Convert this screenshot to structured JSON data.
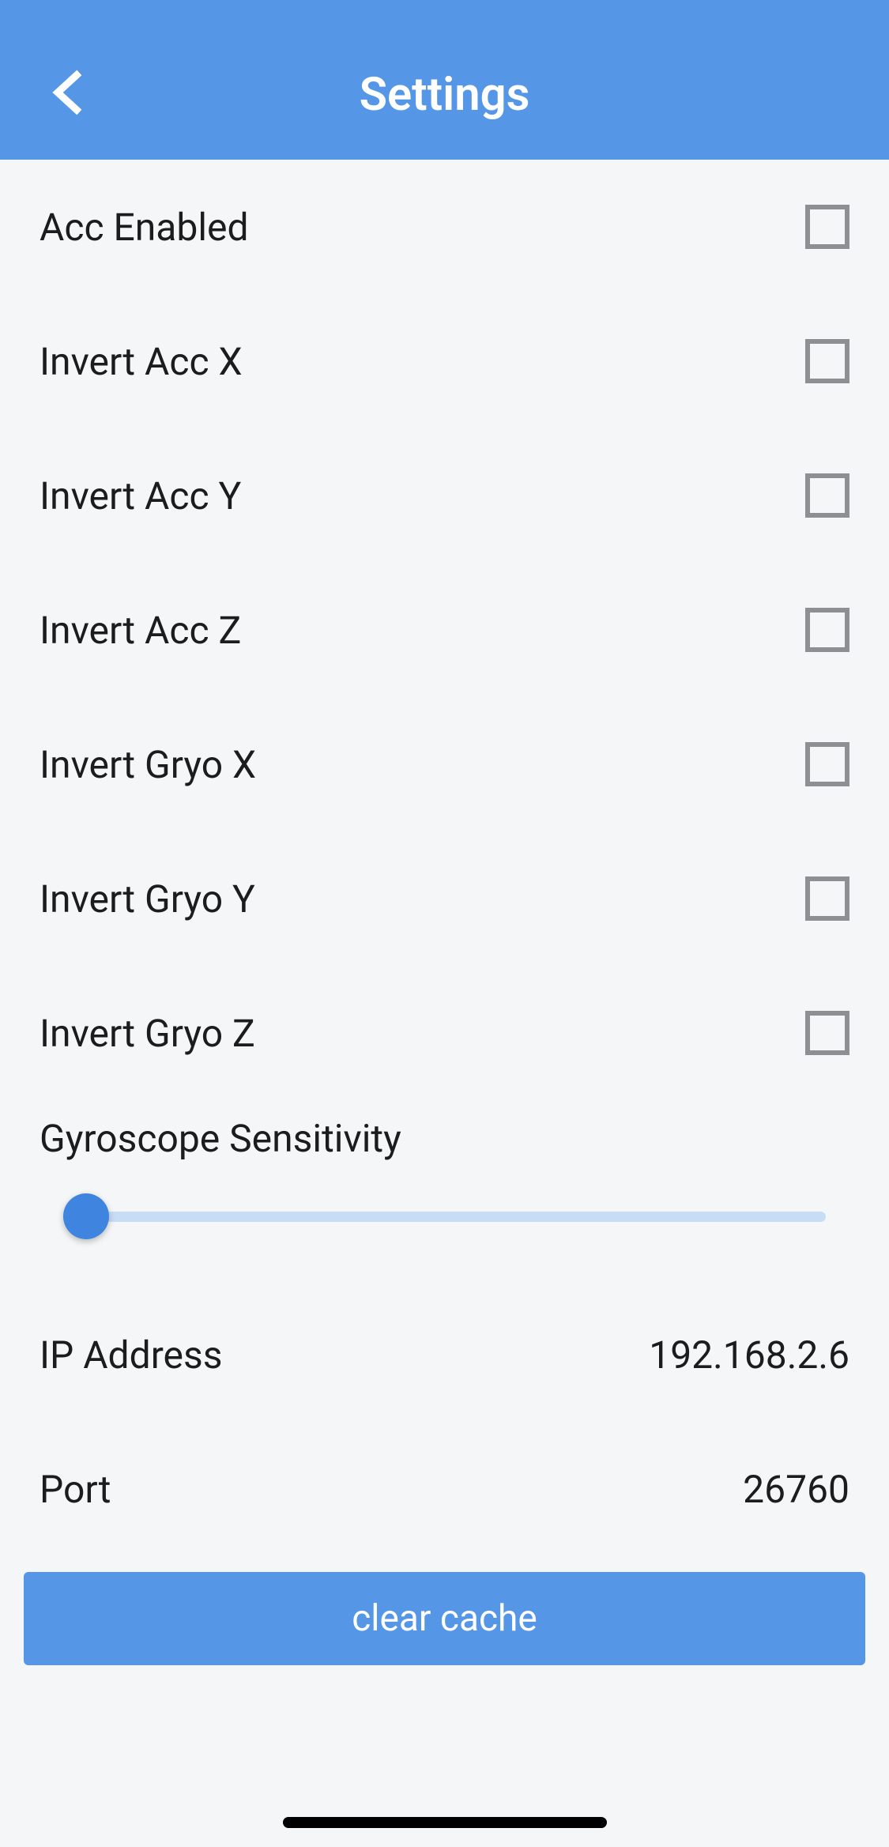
{
  "header": {
    "title": "Settings"
  },
  "checkboxes": [
    {
      "label": "Acc Enabled"
    },
    {
      "label": "Invert Acc X"
    },
    {
      "label": "Invert Acc Y"
    },
    {
      "label": "Invert Acc Z"
    },
    {
      "label": "Invert Gryo X"
    },
    {
      "label": "Invert Gryo Y"
    },
    {
      "label": "Invert Gryo Z"
    }
  ],
  "slider": {
    "label": "Gyroscope Sensitivity"
  },
  "info": {
    "ip_label": "IP Address",
    "ip_value": "192.168.2.6",
    "port_label": "Port",
    "port_value": "26760"
  },
  "clear_button": "clear cache"
}
